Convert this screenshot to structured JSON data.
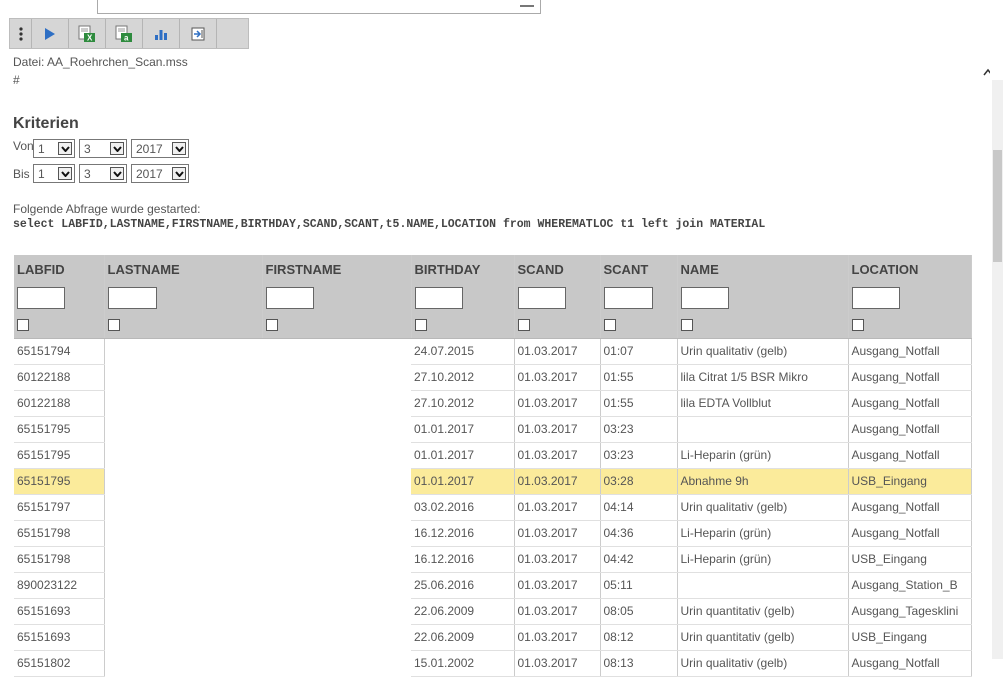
{
  "toolbar": {
    "buttons": [
      {
        "name": "menu-grip-icon"
      },
      {
        "name": "run-icon",
        "color": "#2e6fc4"
      },
      {
        "name": "export-excel-icon",
        "text": "X"
      },
      {
        "name": "export-text-icon",
        "text": "a"
      },
      {
        "name": "chart-icon",
        "color": "#2e6fc4"
      },
      {
        "name": "export-arrow-icon"
      }
    ]
  },
  "header": {
    "datei": "Datei: AA_Roehrchen_Scan.mss",
    "hash": "#",
    "kriterien": "Kriterien"
  },
  "criteria": {
    "von": {
      "label": "Von",
      "day": "1",
      "month": "3",
      "year": "2017"
    },
    "bis": {
      "label": "Bis",
      "day": "1",
      "month": "3",
      "year": "2017"
    }
  },
  "query": {
    "status": "Folgende Abfrage wurde gestarted:",
    "sql": "select LABFID,LASTNAME,FIRSTNAME,BIRTHDAY,SCAND,SCANT,t5.NAME,LOCATION from WHEREMATLOC t1 left join MATERIAL"
  },
  "table": {
    "columns": [
      "LABFID",
      "LASTNAME",
      "FIRSTNAME",
      "BIRTHDAY",
      "SCAND",
      "SCANT",
      "NAME",
      "LOCATION"
    ],
    "rows": [
      {
        "LABFID": "65151794",
        "BIRTHDAY": "24.07.2015",
        "SCAND": "01.03.2017",
        "SCANT": "01:07",
        "NAME": "Urin qualitativ (gelb)",
        "LOCATION": "Ausgang_Notfall"
      },
      {
        "LABFID": "60122188",
        "BIRTHDAY": "27.10.2012",
        "SCAND": "01.03.2017",
        "SCANT": "01:55",
        "NAME": "lila Citrat 1/5 BSR Mikro",
        "LOCATION": "Ausgang_Notfall"
      },
      {
        "LABFID": "60122188",
        "BIRTHDAY": "27.10.2012",
        "SCAND": "01.03.2017",
        "SCANT": "01:55",
        "NAME": "lila EDTA Vollblut",
        "LOCATION": "Ausgang_Notfall"
      },
      {
        "LABFID": "65151795",
        "BIRTHDAY": "01.01.2017",
        "SCAND": "01.03.2017",
        "SCANT": "03:23",
        "NAME": "",
        "LOCATION": "Ausgang_Notfall"
      },
      {
        "LABFID": "65151795",
        "BIRTHDAY": "01.01.2017",
        "SCAND": "01.03.2017",
        "SCANT": "03:23",
        "NAME": "Li-Heparin (grün)",
        "LOCATION": "Ausgang_Notfall"
      },
      {
        "LABFID": "65151795",
        "BIRTHDAY": "01.01.2017",
        "SCAND": "01.03.2017",
        "SCANT": "03:28",
        "NAME": "Abnahme 9h",
        "LOCATION": "USB_Eingang",
        "highlight": true
      },
      {
        "LABFID": "65151797",
        "BIRTHDAY": "03.02.2016",
        "SCAND": "01.03.2017",
        "SCANT": "04:14",
        "NAME": "Urin qualitativ (gelb)",
        "LOCATION": "Ausgang_Notfall"
      },
      {
        "LABFID": "65151798",
        "BIRTHDAY": "16.12.2016",
        "SCAND": "01.03.2017",
        "SCANT": "04:36",
        "NAME": "Li-Heparin (grün)",
        "LOCATION": "Ausgang_Notfall"
      },
      {
        "LABFID": "65151798",
        "BIRTHDAY": "16.12.2016",
        "SCAND": "01.03.2017",
        "SCANT": "04:42",
        "NAME": "Li-Heparin (grün)",
        "LOCATION": "USB_Eingang"
      },
      {
        "LABFID": "890023122",
        "BIRTHDAY": "25.06.2016",
        "SCAND": "01.03.2017",
        "SCANT": "05:11",
        "NAME": "",
        "LOCATION": "Ausgang_Station_B"
      },
      {
        "LABFID": "65151693",
        "BIRTHDAY": "22.06.2009",
        "SCAND": "01.03.2017",
        "SCANT": "08:05",
        "NAME": "Urin quantitativ (gelb)",
        "LOCATION": "Ausgang_Tagesklini"
      },
      {
        "LABFID": "65151693",
        "BIRTHDAY": "22.06.2009",
        "SCAND": "01.03.2017",
        "SCANT": "08:12",
        "NAME": "Urin quantitativ (gelb)",
        "LOCATION": "USB_Eingang"
      },
      {
        "LABFID": "65151802",
        "BIRTHDAY": "15.01.2002",
        "SCAND": "01.03.2017",
        "SCANT": "08:13",
        "NAME": "Urin qualitativ (gelb)",
        "LOCATION": "Ausgang_Notfall"
      }
    ]
  },
  "colors": {
    "highlight": "#fbeb9b",
    "header_bg": "#c8c8c8",
    "toolbar_bg": "#d6d6d6"
  }
}
